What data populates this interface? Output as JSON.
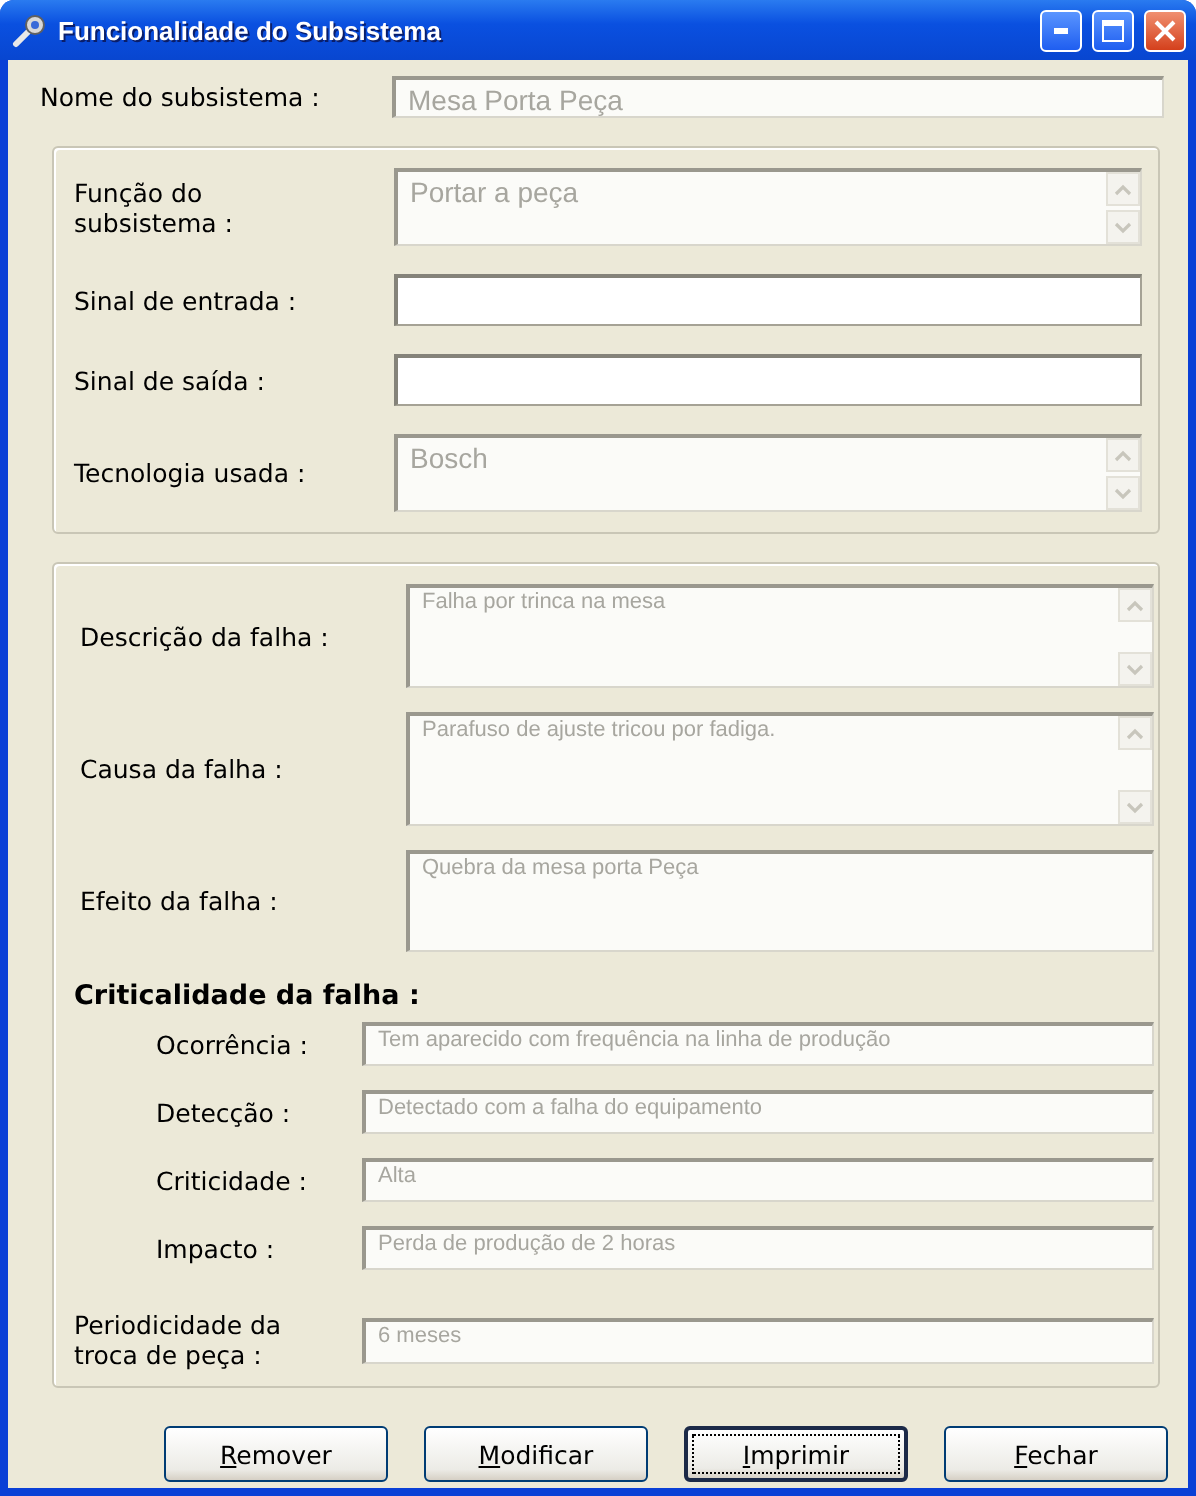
{
  "window": {
    "title": "Funcionalidade do Subsistema"
  },
  "name_field": {
    "label": "Nome do subsistema :",
    "value": "Mesa Porta Peça",
    "disabled": true
  },
  "subsystem_group": {
    "fields": [
      {
        "label": "Função do subsistema :",
        "value": "Portar a peça",
        "disabled": true,
        "scrollbar": true,
        "kind": "memo"
      },
      {
        "label": "Sinal de entrada :",
        "disabled": false,
        "scrollbar": false,
        "kind": "line"
      },
      {
        "label": "Sinal de saída :",
        "disabled": false,
        "scrollbar": false,
        "kind": "line"
      },
      {
        "label": "Tecnologia usada :",
        "value": "Bosch",
        "disabled": true,
        "scrollbar": true,
        "kind": "memo"
      }
    ]
  },
  "failure_group": {
    "fields": [
      {
        "label": "Descrição da falha :",
        "value": "Falha por trinca na mesa",
        "disabled": true,
        "scrollbar": true
      },
      {
        "label": "Causa da falha :",
        "value": "Parafuso de ajuste tricou por fadiga.",
        "disabled": true,
        "scrollbar": true
      },
      {
        "label": "Efeito da falha :",
        "value": "Quebra da mesa porta Peça",
        "disabled": true,
        "scrollbar": false
      }
    ],
    "criticality": {
      "title": "Criticalidade da falha :",
      "fields": [
        {
          "label": "Ocorrência :",
          "value": "Tem aparecido com frequência na linha de produção",
          "disabled": true
        },
        {
          "label": "Detecção :",
          "value": "Detectado com a falha do equipamento",
          "disabled": true
        },
        {
          "label": "Criticidade :",
          "value": "Alta",
          "disabled": true
        },
        {
          "label": "Impacto :",
          "value": "Perda de produção de 2 horas",
          "disabled": true
        }
      ]
    },
    "replacement": {
      "label": "Periodicidade da troca de peça :",
      "value": "6 meses",
      "disabled": true
    }
  },
  "buttons": [
    {
      "label": "Remover",
      "focused": false
    },
    {
      "label": "Modificar",
      "focused": false
    },
    {
      "label": "Imprimir",
      "focused": true
    },
    {
      "label": "Fechar",
      "focused": false
    }
  ]
}
